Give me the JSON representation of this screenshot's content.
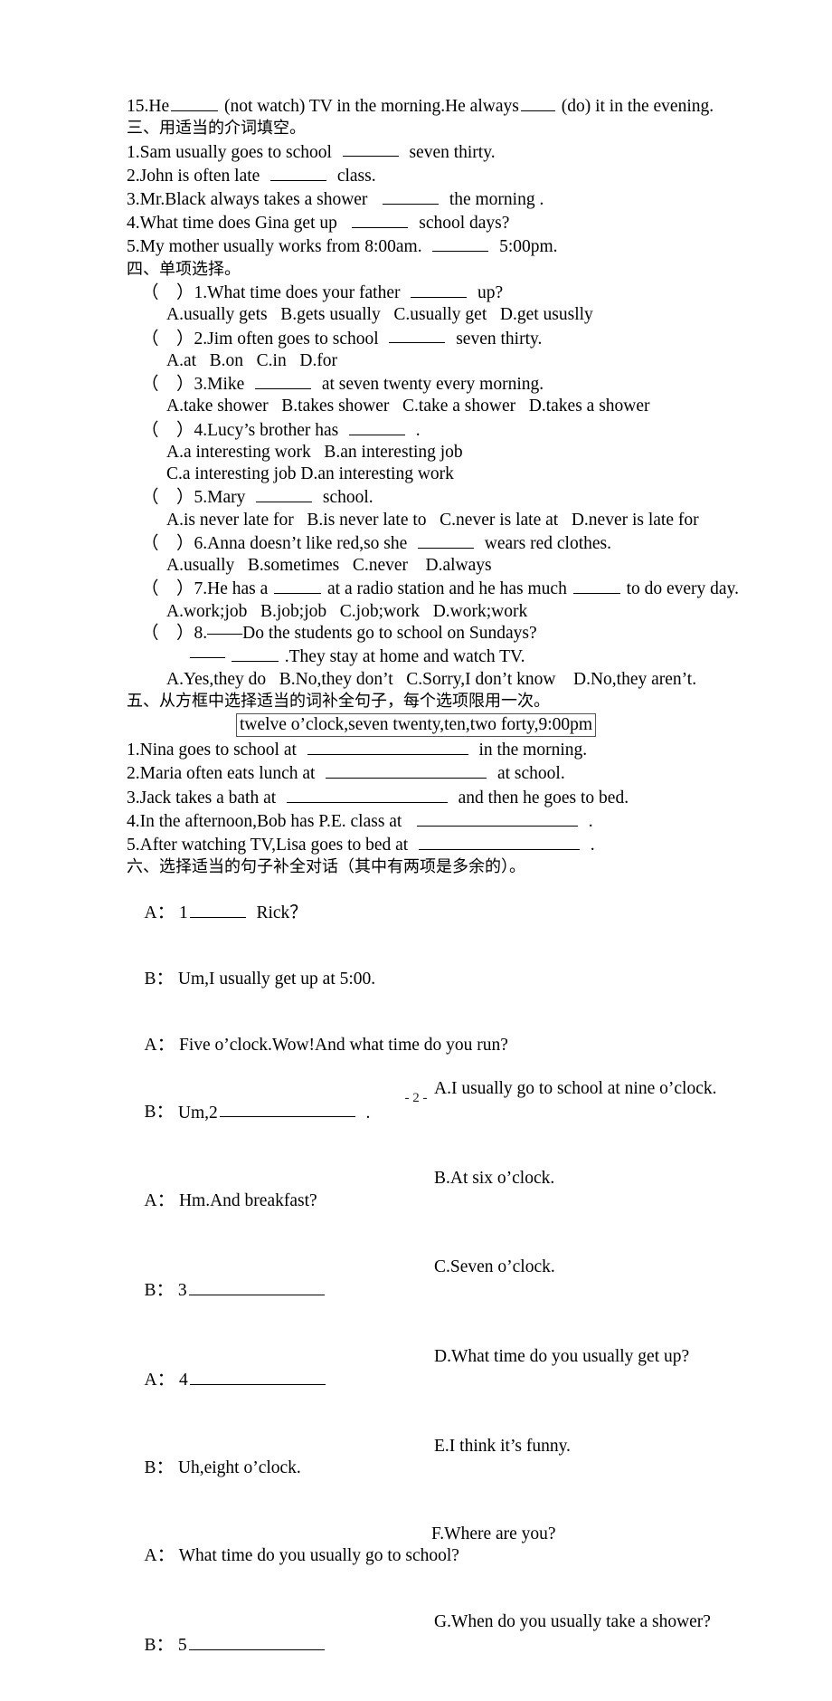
{
  "document": {
    "page_number": "- 2 -",
    "page_label": "- 2 -"
  },
  "carryover_item": {
    "text_before": "15.He",
    "text_mid": "(not watch) TV in the morning.He always",
    "text_after": "(do) it in the evening."
  },
  "section_three": {
    "heading": "三、用适当的介词填空。",
    "items": [
      {
        "before": "1.Sam usually goes to school",
        "after": "seven thirty."
      },
      {
        "before": "2.John is often late",
        "after": "class."
      },
      {
        "before": "3.Mr.Black always takes a shower",
        "after": "the morning ."
      },
      {
        "before": "4.What time does Gina get up",
        "after": "school days?"
      },
      {
        "before": "5.My mother usually works from 8:00am.",
        "after": "5:00pm."
      }
    ]
  },
  "section_four": {
    "heading": "四、单项选择。",
    "bracket": "（    ）",
    "questions": [
      {
        "number": "1.",
        "stem_before": "What time does your father",
        "stem_after": "up?",
        "options": [
          "A.usually gets",
          "B.gets usually",
          "C.usually get",
          "D.get ususlly"
        ],
        "options_line2": ""
      },
      {
        "number": "2.",
        "stem_before": "Jim often goes to school",
        "stem_after": "seven thirty.",
        "options": [
          "A.at",
          "B.on",
          "C.in",
          "D.for"
        ],
        "options_line2": ""
      },
      {
        "number": "3.",
        "stem_before": "Mike",
        "stem_after": "at seven twenty every morning.",
        "options": [
          "A.take shower",
          "B.takes shower",
          "C.take a shower",
          "D.takes a shower"
        ],
        "options_line2": ""
      },
      {
        "number": "4.",
        "stem_before": "Lucy’s brother has",
        "stem_after": ".",
        "options": [
          "A.a interesting work",
          "B.an interesting job"
        ],
        "options_line2": "C.a interesting job D.an interesting work"
      },
      {
        "number": "5.",
        "stem_before": "Mary",
        "stem_after": "school.",
        "options": [
          "A.is never late for",
          "B.is never late to",
          "C.never is late at",
          "D.never is late for"
        ],
        "options_line2": ""
      },
      {
        "number": "6.",
        "stem_before": "Anna doesn’t like red,so she",
        "stem_after": "wears red clothes.",
        "options": [
          "A.usually",
          "B.sometimes",
          "C.never",
          "D.always"
        ],
        "options_line2": ""
      },
      {
        "number": "7.",
        "stem_before": "He has a",
        "stem_mid": "at a radio station and he has much",
        "stem_after": "to do every day.",
        "options": [
          "A.work;job",
          "B.job;job",
          "C.job;work",
          "D.work;work"
        ],
        "options_line2": ""
      },
      {
        "number": "8.",
        "stem_before": "——Do the students go to school on Sundays?",
        "stem_line2_before": "——",
        "stem_line2_after": ".They stay at home and watch TV.",
        "options": [
          "A.Yes,they do",
          "B.No,they don’t",
          "C.Sorry,I don’t know",
          "D.No,they aren’t."
        ],
        "options_line2": ""
      }
    ]
  },
  "section_five": {
    "heading": "五、从方框中选择适当的词补全句子，每个选项限用一次。",
    "word_bank": "twelve o’clock,seven twenty,ten,two forty,9:00pm",
    "items": [
      {
        "before": "1.Nina goes to school at",
        "after": "in the morning."
      },
      {
        "before": "2.Maria often eats lunch at",
        "after": "at school."
      },
      {
        "before": "3.Jack takes a bath at",
        "after": "and then he goes to bed."
      },
      {
        "before": "4.In the afternoon,Bob has P.E. class at",
        "after": "."
      },
      {
        "before": "5.After watching TV,Lisa goes to bed at",
        "after": "."
      }
    ]
  },
  "section_six": {
    "heading": "六、选择适当的句子补全对话（其中有两项是多余的）。",
    "dialogue": [
      {
        "speaker": "A：",
        "text_before": "1",
        "blank": true,
        "text_after": "Rick？",
        "option": ""
      },
      {
        "speaker": "B：",
        "text_before": "Um,I usually get up at 5:00.",
        "blank": false,
        "text_after": "",
        "option": ""
      },
      {
        "speaker": "A：",
        "text_before": "Five o’clock.Wow!And what time do you run?",
        "blank": false,
        "text_after": "",
        "option": ""
      },
      {
        "speaker": "B：",
        "text_before": "Um,2",
        "blank": true,
        "text_after": ".",
        "option": "A.I usually go to school at nine o’clock."
      },
      {
        "speaker": "A：",
        "text_before": "Hm.And breakfast?",
        "blank": false,
        "text_after": "",
        "option": "B.At six o’clock."
      },
      {
        "speaker": "B：",
        "text_before": "3",
        "blank": true,
        "text_after": "",
        "option": "C.Seven o’clock."
      },
      {
        "speaker": "A：",
        "text_before": "4",
        "blank": true,
        "text_after": "",
        "option": "D.What time do you usually get up?"
      },
      {
        "speaker": "B：",
        "text_before": "Uh,eight o’clock.",
        "blank": false,
        "text_after": "",
        "option": "E.I think it’s funny."
      },
      {
        "speaker": "A：",
        "text_before": "What time do you usually go to school?",
        "blank": false,
        "text_after": "",
        "option": "F.Where are you?"
      },
      {
        "speaker": "B：",
        "text_before": "5",
        "blank": true,
        "text_after": "",
        "option": "G.When do you usually take a shower?"
      }
    ]
  }
}
